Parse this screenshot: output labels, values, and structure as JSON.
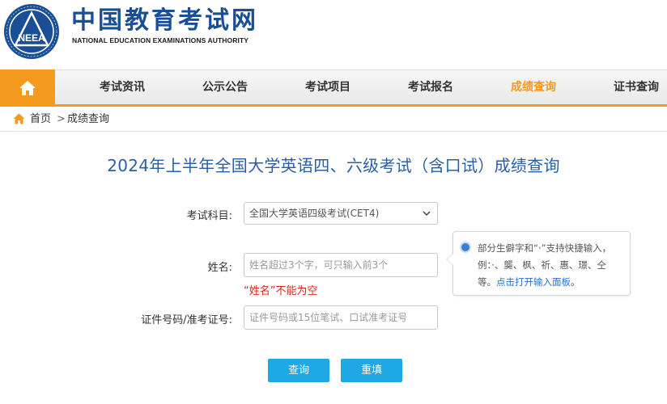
{
  "header": {
    "logo_emblem_text": "NEEA",
    "logo_cn": "中国教育考试网",
    "logo_en": "NATIONAL EDUCATION EXAMINATIONS AUTHORITY"
  },
  "nav": {
    "home_icon": "home-icon",
    "items": [
      {
        "label": "考试资讯"
      },
      {
        "label": "公示公告"
      },
      {
        "label": "考试项目"
      },
      {
        "label": "考试报名"
      },
      {
        "label": "成绩查询",
        "active": true
      },
      {
        "label": "证书查询"
      }
    ],
    "accent_color": "#f39a1f"
  },
  "breadcrumb": {
    "home": "首页",
    "separator": ">",
    "current": "成绩查询"
  },
  "page_title": "2024年上半年全国大学英语四、六级考试（含口试）成绩查询",
  "form": {
    "subject_label": "考试科目:",
    "subject_value": "全国大学英语四级考试(CET4)",
    "name_label": "姓名:",
    "name_placeholder": "姓名超过3个字，可只输入前3个",
    "name_error": "“姓名”不能为空",
    "id_label": "证件号码/准考证号:",
    "id_placeholder": "证件号码或15位笔试、口试准考证号"
  },
  "tooltip": {
    "text": "部分生僻字和“·”支持快捷输入，例：·、龑、枫、祈、惠、璟、仝等。",
    "link": "点击打开输入面板",
    "end": "。"
  },
  "buttons": {
    "query": "查询",
    "reset": "重填",
    "color": "#1ea8e6"
  }
}
